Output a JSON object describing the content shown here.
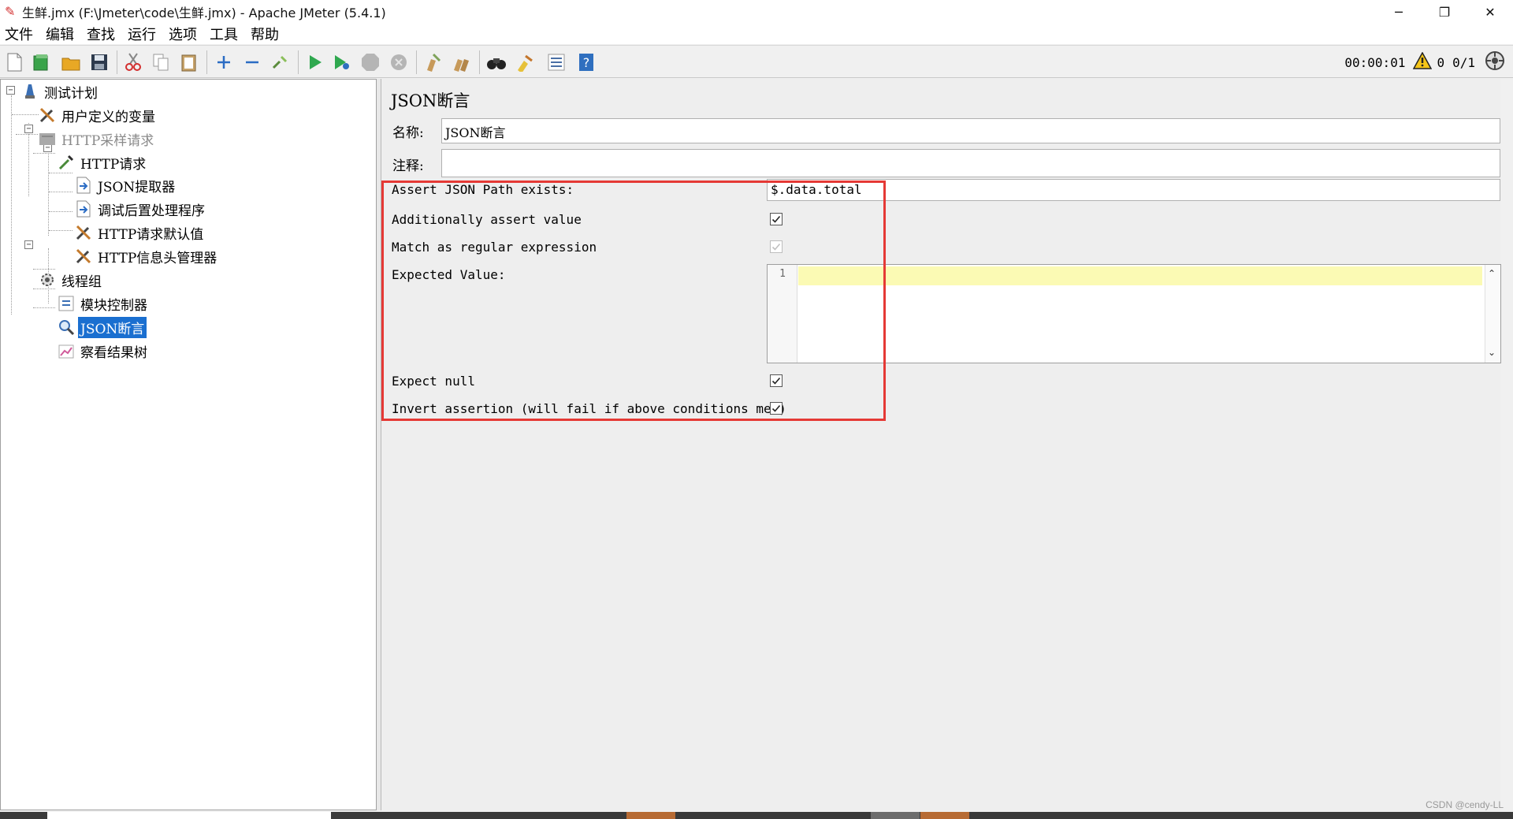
{
  "window": {
    "title": "生鲜.jmx (F:\\Jmeter\\code\\生鲜.jmx) - Apache JMeter (5.4.1)",
    "controls": [
      "─",
      "❐",
      "✕"
    ]
  },
  "menu": [
    "文件",
    "编辑",
    "查找",
    "运行",
    "选项",
    "工具",
    "帮助"
  ],
  "toolbar": {
    "buttons": [
      "new-icon",
      "templates-icon",
      "open-icon",
      "save-icon",
      "cut-icon",
      "copy-icon",
      "paste-icon",
      "expand-icon",
      "collapse-icon",
      "toggle-icon",
      "start-icon",
      "start-no-pause-icon",
      "stop-icon",
      "shutdown-icon",
      "clear-icon",
      "clear-all-icon",
      "search-icon",
      "reset-search-icon",
      "function-helper-icon",
      "help-icon"
    ],
    "timer": "00:00:01",
    "warning_count": "0",
    "threads": "0/1"
  },
  "tree": [
    {
      "label": "测试计划",
      "icon": "test-plan-icon",
      "level": 0,
      "expander": "−"
    },
    {
      "label": "用户定义的变量",
      "icon": "wrench-icon",
      "level": 1
    },
    {
      "label": "HTTP采样请求",
      "icon": "sampler-disabled-icon",
      "level": 1,
      "expander": "−",
      "disabled": true
    },
    {
      "label": "HTTP请求",
      "icon": "pipette-icon",
      "level": 2,
      "expander": "−"
    },
    {
      "label": "JSON提取器",
      "icon": "extractor-icon",
      "level": 3
    },
    {
      "label": "调试后置处理程序",
      "icon": "postprocessor-icon",
      "level": 3
    },
    {
      "label": "HTTP请求默认值",
      "icon": "wrench-icon",
      "level": 3
    },
    {
      "label": "HTTP信息头管理器",
      "icon": "wrench-icon",
      "level": 3
    },
    {
      "label": "线程组",
      "icon": "gear-icon",
      "level": 1,
      "expander": "−"
    },
    {
      "label": "模块控制器",
      "icon": "module-controller-icon",
      "level": 2
    },
    {
      "label": "JSON断言",
      "icon": "magnifier-icon",
      "level": 2,
      "selected": true
    },
    {
      "label": "察看结果树",
      "icon": "chart-icon",
      "level": 2
    }
  ],
  "panel": {
    "title": "JSON断言",
    "name_label": "名称:",
    "name_value": "JSON断言",
    "comment_label": "注释:",
    "comment_value": "",
    "assert_path_label": "Assert JSON Path exists:",
    "assert_path_value": "$.data.total",
    "additionally_label": "Additionally assert value",
    "additionally_checked": true,
    "regex_label": "Match as regular expression",
    "regex_checked": true,
    "expected_label": "Expected Value:",
    "expected_line_number": "1",
    "expected_value": "",
    "expect_null_label": "Expect null",
    "expect_null_checked": true,
    "invert_label": "Invert assertion (will fail if above conditions met)",
    "invert_checked": true
  },
  "watermark": "CSDN @cendy-LL",
  "colors": {
    "selection": "#1a6fd0",
    "highlight_box": "#e53935",
    "current_line": "#fbfab4"
  }
}
